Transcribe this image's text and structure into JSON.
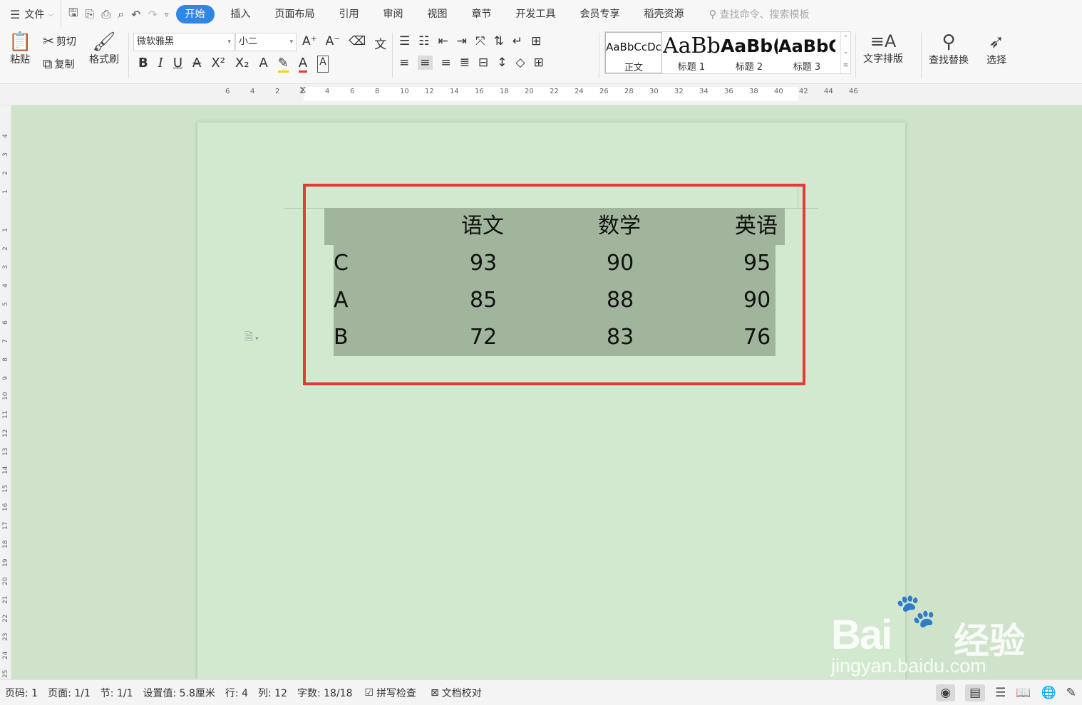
{
  "menubar": {
    "file_label": "文件",
    "tabs": [
      "开始",
      "插入",
      "页面布局",
      "引用",
      "审阅",
      "视图",
      "章节",
      "开发工具",
      "会员专享",
      "稻壳资源"
    ],
    "active_tab": "开始",
    "search_placeholder": "查找命令、搜索模板"
  },
  "ribbon": {
    "paste": "粘贴",
    "cut": "剪切",
    "copy": "复制",
    "format_painter": "格式刷",
    "font_name": "微软雅黑",
    "font_size": "小二",
    "styles": [
      {
        "sample": "AaBbCcDc",
        "name": "正文"
      },
      {
        "sample": "AaBb",
        "name": "标题 1"
      },
      {
        "sample": "AaBb(",
        "name": "标题 2"
      },
      {
        "sample": "AaBbC",
        "name": "标题 3"
      }
    ],
    "text_layout": "文字排版",
    "find_replace": "查找替换",
    "select": "选择"
  },
  "ruler": {
    "h_ticks": [
      "6",
      "4",
      "2",
      "2",
      "4",
      "6",
      "8",
      "10",
      "12",
      "14",
      "16",
      "18",
      "20",
      "22",
      "24",
      "26",
      "28",
      "30",
      "32",
      "34",
      "36",
      "38",
      "40",
      "42",
      "44",
      "46"
    ],
    "v_ticks": [
      "4",
      "3",
      "2",
      "1",
      "1",
      "2",
      "3",
      "4",
      "5",
      "6",
      "7",
      "8",
      "9",
      "10",
      "11",
      "12",
      "13",
      "14",
      "15",
      "16",
      "17",
      "18",
      "19",
      "20",
      "21",
      "22",
      "23",
      "24",
      "25"
    ]
  },
  "table": {
    "headers": [
      "",
      "语文",
      "数学",
      "英语"
    ],
    "rows": [
      [
        "C",
        "93",
        "90",
        "95"
      ],
      [
        "A",
        "85",
        "88",
        "90"
      ],
      [
        "B",
        "72",
        "83",
        "76"
      ]
    ]
  },
  "status": {
    "page_num": "页码: 1",
    "pages": "页面: 1/1",
    "section": "节: 1/1",
    "setting": "设置值: 5.8厘米",
    "row": "行: 4",
    "col": "列: 12",
    "word_count": "字数: 18/18",
    "spell_check": "拼写检查",
    "doc_proof": "文档校对"
  },
  "watermark": {
    "brand": "Bai",
    "brand_cn": "经验",
    "url": "jingyan.baidu.com"
  },
  "colors": {
    "accent": "#2f86e6",
    "highlight_border": "#e53935",
    "table_fill": "#a0b59c",
    "page_bg": "#d3e9cf"
  }
}
